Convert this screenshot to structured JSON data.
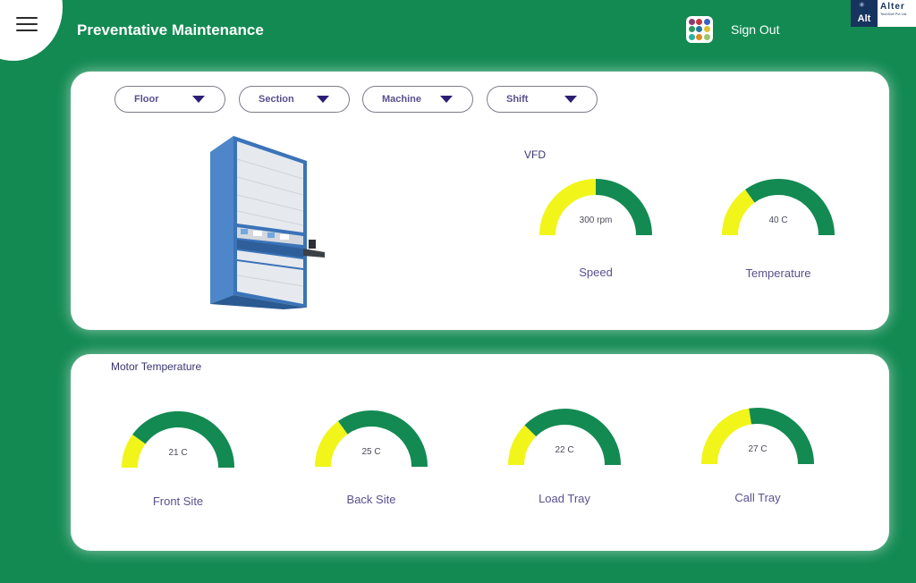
{
  "header": {
    "title": "Preventative Maintenance",
    "sign_out": "Sign Out",
    "logo_mark": "Alt",
    "logo_name": "Alter",
    "logo_sub": "TechSoft Pvt Ltd."
  },
  "apps_icon_colors": [
    "#8a3a6e",
    "#c23a3a",
    "#3b63c4",
    "#2a9a5a",
    "#1e7a9e",
    "#e0c030",
    "#2ab0a0",
    "#e08a20",
    "#98c86a"
  ],
  "filters": [
    {
      "label": "Floor"
    },
    {
      "label": "Section"
    },
    {
      "label": "Machine"
    },
    {
      "label": "Shift"
    }
  ],
  "vfd": {
    "label": "VFD",
    "gauges": [
      {
        "value_text": "300 rpm",
        "title": "Speed",
        "fraction": 0.5
      },
      {
        "value_text": "40 C",
        "title": "Temperature",
        "fraction": 0.3
      }
    ]
  },
  "motor": {
    "label": "Motor Temperature",
    "gauges": [
      {
        "value_text": "21 C",
        "title": "Front Site",
        "fraction": 0.2
      },
      {
        "value_text": "25 C",
        "title": "Back Site",
        "fraction": 0.3
      },
      {
        "value_text": "22 C",
        "title": "Load Tray",
        "fraction": 0.25
      },
      {
        "value_text": "27 C",
        "title": "Call Tray",
        "fraction": 0.45
      }
    ]
  },
  "colors": {
    "background": "#138a52",
    "gauge_fill": "#f1f51a",
    "gauge_track": "#138a52",
    "label": "#5a4f8e"
  }
}
